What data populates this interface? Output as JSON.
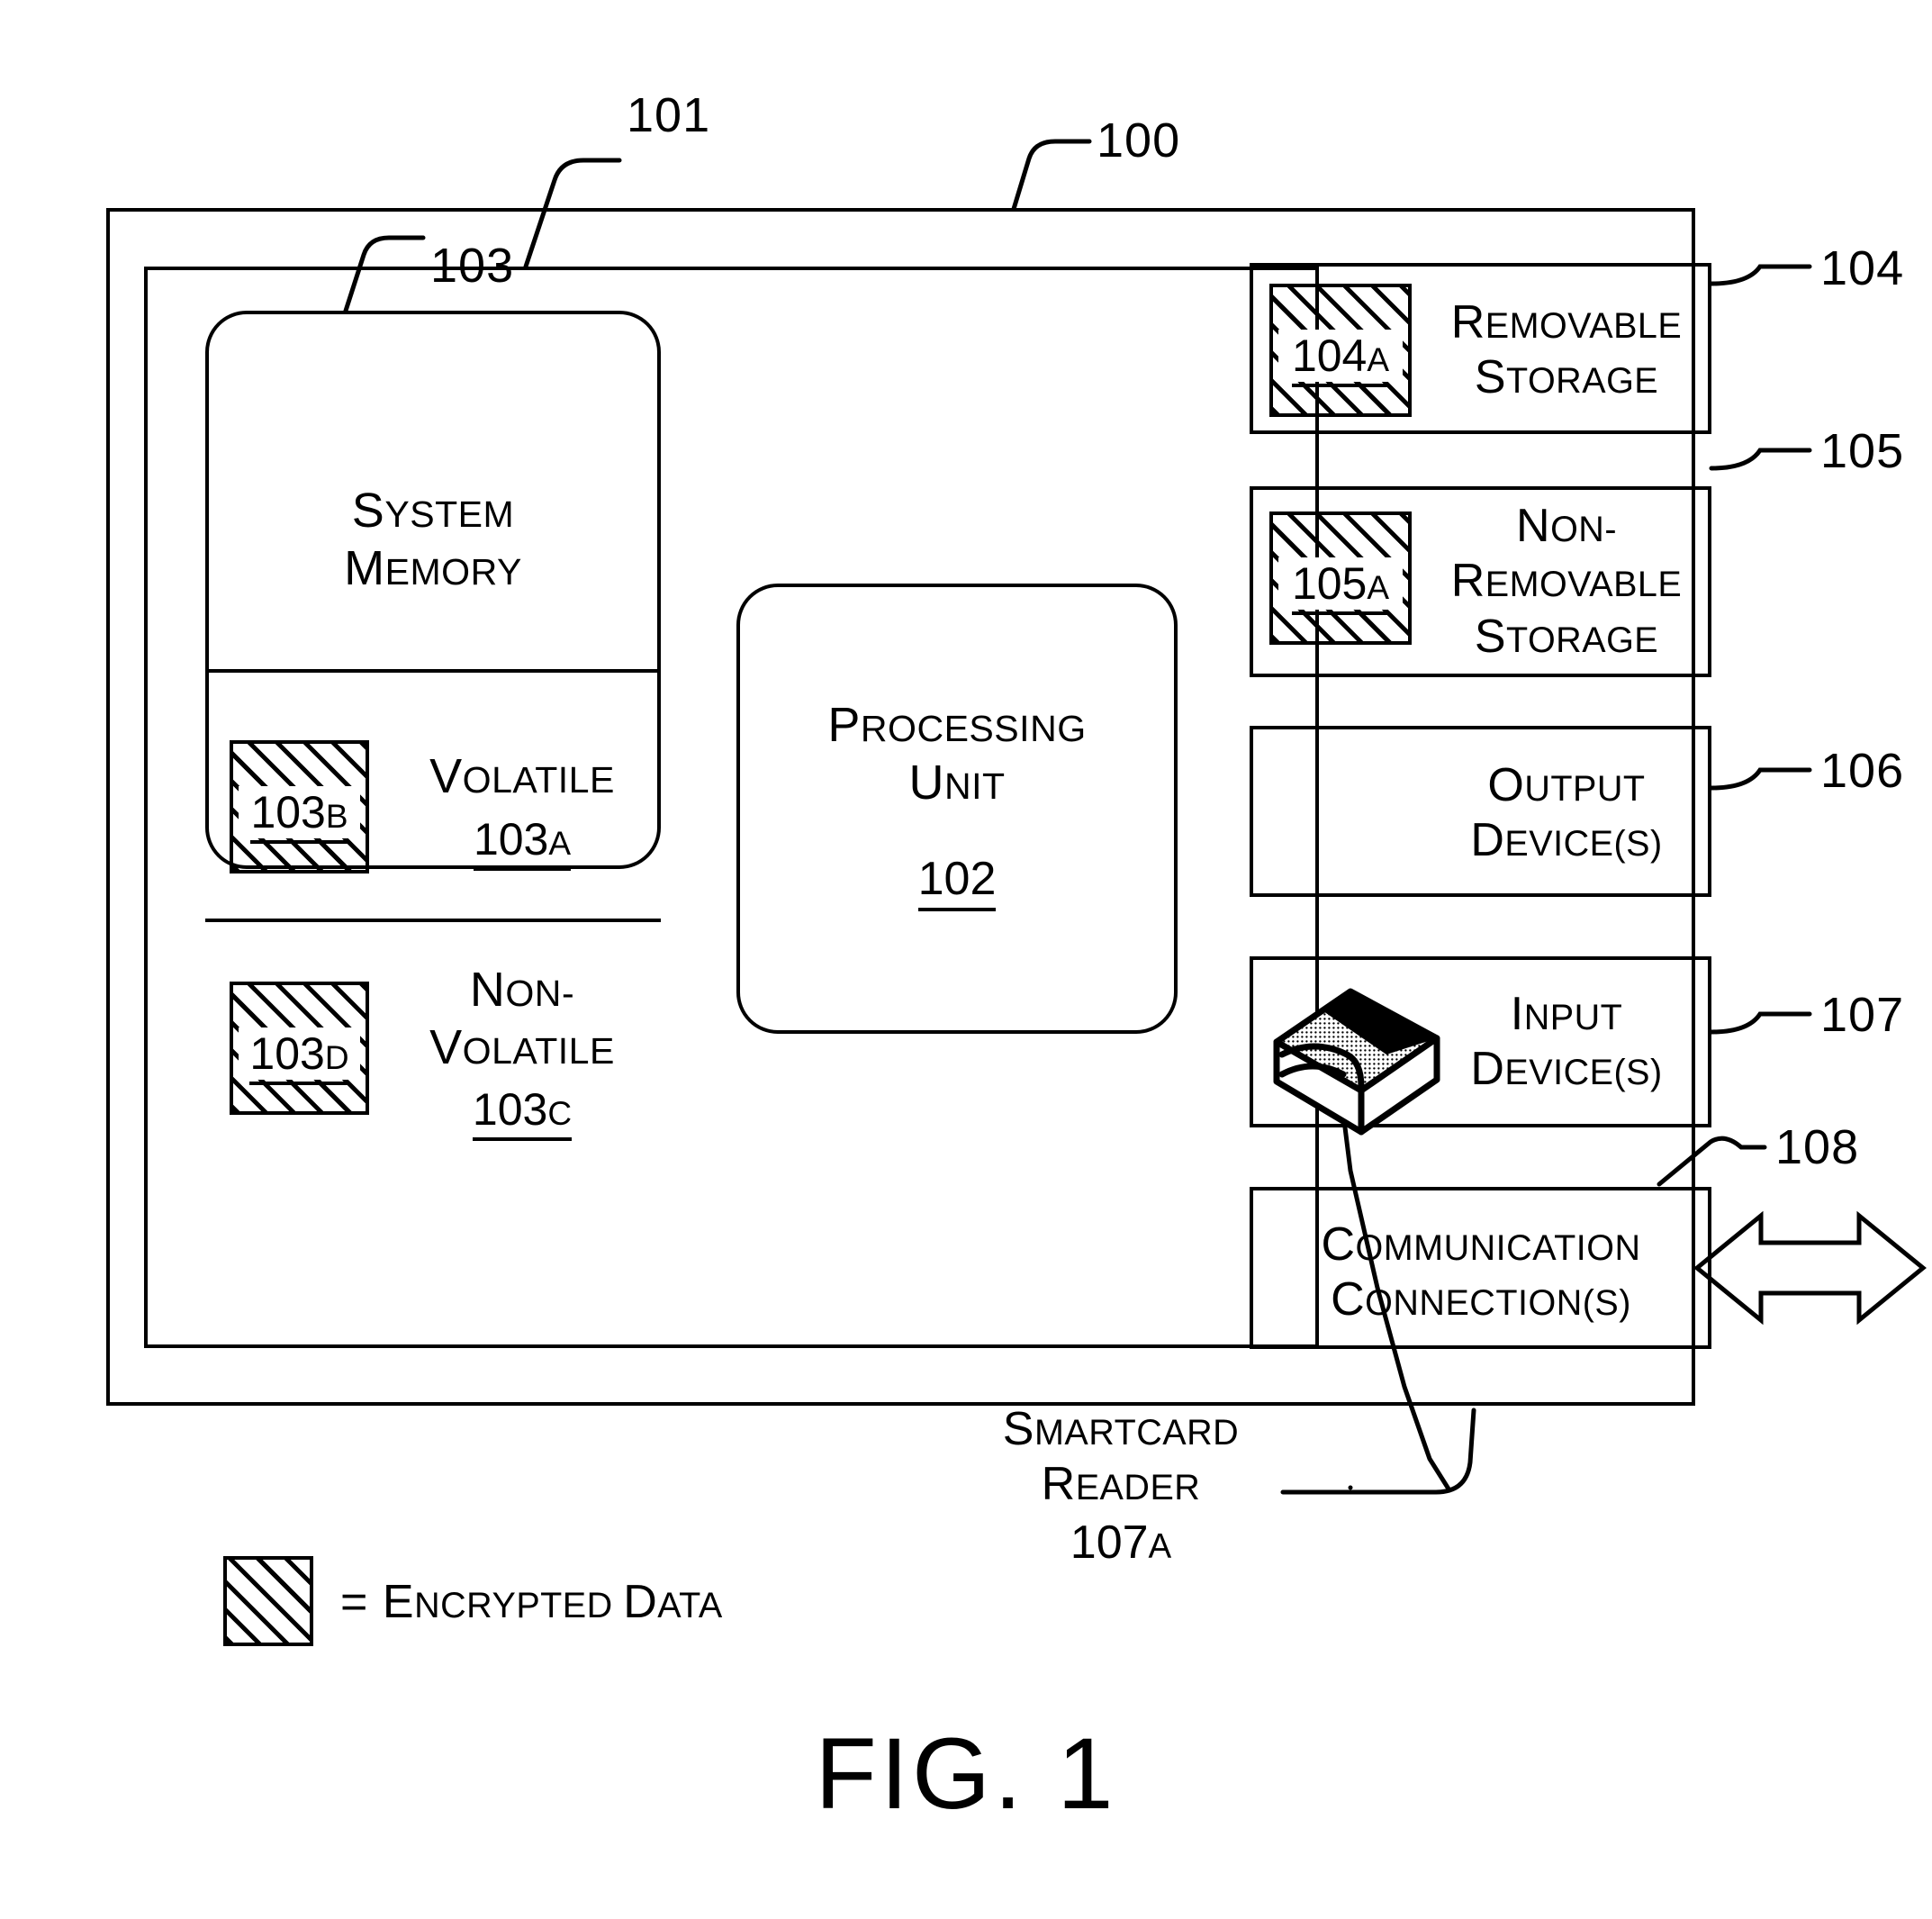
{
  "figure": {
    "caption": "FIG. 1",
    "legend": {
      "equals": "=",
      "label": "Encrypted Data",
      "label_first": "E",
      "label_rest": "NCRYPTED ",
      "label_first2": "D",
      "label_rest2": "ATA"
    }
  },
  "outer_box": {
    "ref": "100"
  },
  "inner_box": {
    "ref": "101"
  },
  "system_memory": {
    "ref": "103",
    "title_line1_first": "S",
    "title_line1_rest": "YSTEM",
    "title_line2_first": "M",
    "title_line2_rest": "EMORY",
    "title": "System Memory",
    "volatile": {
      "label_first": "V",
      "label_rest": "OLATILE",
      "label": "Volatile",
      "tag": "103A",
      "tag_num": "103",
      "tag_letter": "A",
      "encrypted_tag": "103B",
      "encrypted_num": "103",
      "encrypted_letter": "B"
    },
    "non_volatile": {
      "label_line1_first": "N",
      "label_line1_rest": "ON-",
      "label_line2_first": "V",
      "label_line2_rest": "OLATILE",
      "label": "Non-Volatile",
      "tag": "103C",
      "tag_num": "103",
      "tag_letter": "C",
      "encrypted_tag": "103D",
      "encrypted_num": "103",
      "encrypted_letter": "D"
    }
  },
  "processing_unit": {
    "title_line1_first": "P",
    "title_line1_rest": "ROCESSING",
    "title_line2_first": "U",
    "title_line2_rest": "NIT",
    "title": "Processing Unit",
    "tag": "102"
  },
  "right_blocks": [
    {
      "name": "removable-storage",
      "ref": "104",
      "line1_first": "R",
      "line1_rest": "EMOVABLE",
      "line2_first": "S",
      "line2_rest": "TORAGE",
      "label": "Removable Storage",
      "encrypted_tag": "104A",
      "encrypted_num": "104",
      "encrypted_letter": "A",
      "has_encrypted": true
    },
    {
      "name": "non-removable-storage",
      "ref": "105",
      "line1_first": "N",
      "line1_rest": "ON-",
      "line2_first": "R",
      "line2_rest": "EMOVABLE",
      "line3_first": "S",
      "line3_rest": "TORAGE",
      "label": "Non-Removable Storage",
      "encrypted_tag": "105A",
      "encrypted_num": "105",
      "encrypted_letter": "A",
      "has_encrypted": true
    },
    {
      "name": "output-devices",
      "ref": "106",
      "line1_first": "O",
      "line1_rest": "UTPUT",
      "line2_first": "D",
      "line2_rest": "EVICE(S)",
      "label": "Output Device(s)",
      "has_encrypted": false
    },
    {
      "name": "input-devices",
      "ref": "107",
      "line1_first": "I",
      "line1_rest": "NPUT",
      "line2_first": "D",
      "line2_rest": "EVICE(S)",
      "label": "Input Device(s)",
      "has_encrypted": false,
      "icon": "smartcard-reader-icon"
    },
    {
      "name": "communication-connections",
      "ref": "108",
      "line1_first": "C",
      "line1_rest": "OMMUNICATION",
      "line2_first": "C",
      "line2_rest": "ONNECTION(S)",
      "label": "Communication Connection(s)",
      "has_encrypted": false,
      "arrow": "bidirectional-arrow-icon"
    }
  ],
  "smartcard_reader_callout": {
    "line1_first": "S",
    "line1_rest": "MARTCARD",
    "line2_first": "R",
    "line2_rest": "EADER",
    "label": "Smartcard Reader",
    "tag": "107A",
    "tag_num": "107",
    "tag_letter": "A"
  },
  "colors": {
    "ink": "#000000",
    "paper": "#ffffff"
  }
}
